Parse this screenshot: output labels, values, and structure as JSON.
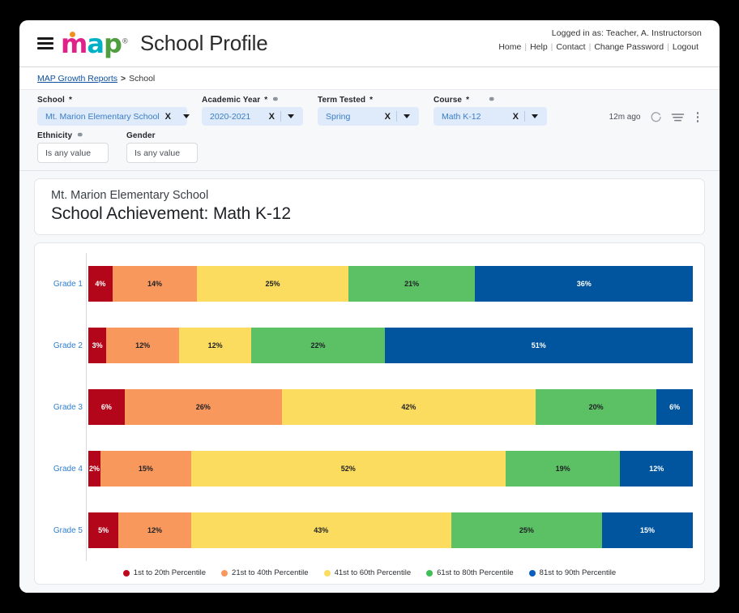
{
  "header": {
    "logo_text": "map",
    "app_title": "School Profile",
    "logged_in_as": "Logged in as:  Teacher, A. Instructorson",
    "nav_links": [
      "Home",
      "Help",
      "Contact",
      "Change Password",
      "Logout"
    ]
  },
  "breadcrumb": {
    "root": "MAP Growth Reports",
    "separator": ">",
    "current": "School"
  },
  "filters": {
    "row1": [
      {
        "label": "School",
        "required": "*",
        "chain": false,
        "value": "Mt. Marion Elementary School",
        "clear": "X",
        "class": "pill-school"
      },
      {
        "label": "Academic Year",
        "required": "*",
        "chain": true,
        "value": "2020-2021",
        "clear": "X",
        "class": "pill-year"
      },
      {
        "label": "Term Tested",
        "required": "*",
        "chain": false,
        "value": "Spring",
        "clear": "X",
        "class": "pill-term"
      },
      {
        "label": "Course",
        "required": "*",
        "chain": true,
        "value": "Math K-12",
        "clear": "X",
        "class": "pill-course"
      }
    ],
    "row2": [
      {
        "label": "Ethnicity",
        "chain": true,
        "value": "Is any value"
      },
      {
        "label": "Gender",
        "chain": false,
        "value": "Is any value"
      }
    ],
    "toolbar": {
      "updated": "12m ago",
      "refresh_icon": "refresh-icon",
      "filter_icon": "filter-icon",
      "more_icon": "more-vertical-icon"
    }
  },
  "report": {
    "school_name": "Mt. Marion Elementary School",
    "title": "School Achievement: Math K-12"
  },
  "chart_data": {
    "type": "bar",
    "orientation": "horizontal",
    "stacked": true,
    "stack_total": 100,
    "title": "School Achievement: Math K-12",
    "xlabel": "",
    "ylabel": "",
    "xlim": [
      0,
      100
    ],
    "grid": false,
    "legend_position": "bottom",
    "value_suffix": "%",
    "categories": [
      "Grade 1",
      "Grade 2",
      "Grade 3",
      "Grade 4",
      "Grade 5"
    ],
    "series": [
      {
        "name": "1st to 20th Percentile",
        "color": "#B3061A",
        "text_color": "#ffffff",
        "values": [
          4,
          3,
          6,
          2,
          5
        ]
      },
      {
        "name": "21st to 40th Percentile",
        "color": "#F9985C",
        "text_color": "#1d2024",
        "values": [
          14,
          12,
          26,
          15,
          12
        ]
      },
      {
        "name": "41st to 60th Percentile",
        "color": "#FCDC5E",
        "text_color": "#1d2024",
        "values": [
          25,
          12,
          42,
          52,
          43
        ]
      },
      {
        "name": "61st to 80th Percentile",
        "color": "#5CC165",
        "text_color": "#1d2024",
        "values": [
          21,
          22,
          20,
          19,
          25
        ]
      },
      {
        "name": "81st to 90th Percentile",
        "color": "#00559E",
        "text_color": "#ffffff",
        "values": [
          36,
          51,
          6,
          12,
          15
        ]
      }
    ],
    "legend": [
      {
        "label": "1st to 20th Percentile",
        "color": "#C0071E"
      },
      {
        "label": "21st to 40th Percentile",
        "color": "#F9985C"
      },
      {
        "label": "41st to 60th Percentile",
        "color": "#FCDC5E"
      },
      {
        "label": "61st to 80th Percentile",
        "color": "#3FBF55"
      },
      {
        "label": "81st to 90th Percentile",
        "color": "#0B5FC0"
      }
    ]
  }
}
